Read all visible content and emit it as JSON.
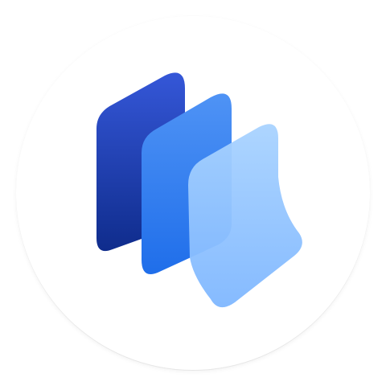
{
  "app_icon": {
    "name": "layered-pages-app-icon",
    "background_color": "#ffffff",
    "colors": {
      "back_panel_top": "#3557D8",
      "back_panel_bottom": "#0F2C8C",
      "middle_panel_top": "#4F93F5",
      "middle_panel_bottom": "#1F6EEA",
      "front_page_top": "#A9D3FF",
      "front_page_bottom": "#7FB7FF"
    }
  }
}
